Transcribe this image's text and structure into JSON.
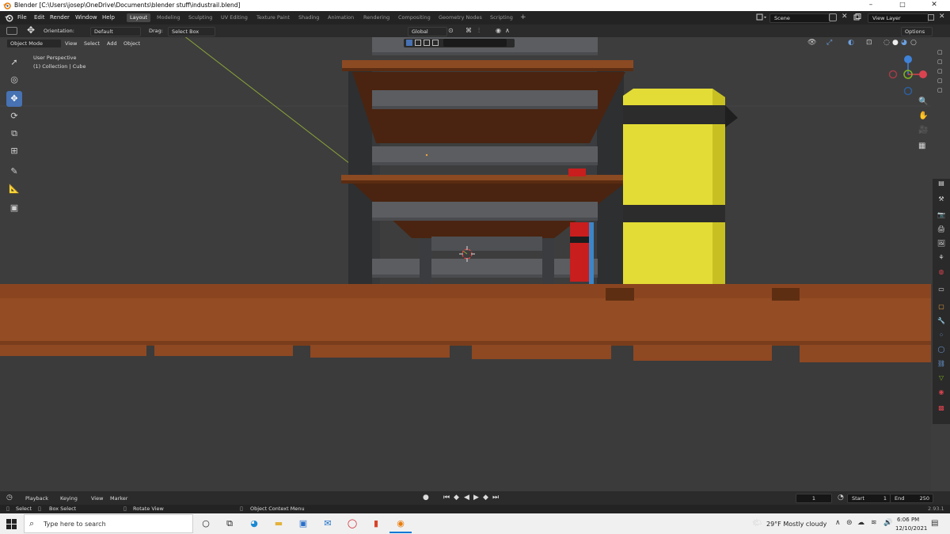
{
  "window": {
    "title": "Blender [C:\\Users\\josep\\OneDrive\\Documents\\blender stuff\\industrail.blend]",
    "controls": [
      "–",
      "□",
      "✕"
    ]
  },
  "menubar": {
    "menus": [
      "File",
      "Edit",
      "Render",
      "Window",
      "Help"
    ],
    "workspaces": [
      "Layout",
      "Modeling",
      "Sculpting",
      "UV Editing",
      "Texture Paint",
      "Shading",
      "Animation",
      "Rendering",
      "Compositing",
      "Geometry Nodes",
      "Scripting"
    ],
    "active_workspace": "Layout",
    "add_workspace": "+",
    "scene": "Scene",
    "view_layer": "View Layer"
  },
  "toolheader": {
    "orientation_label": "Orientation:",
    "orientation_value": "Default",
    "drag_label": "Drag:",
    "drag_value": "Select Box",
    "transform_orientation": "Global",
    "options": "Options"
  },
  "viewheader": {
    "mode": "Object Mode",
    "menus": [
      "View",
      "Select",
      "Add",
      "Object"
    ]
  },
  "viewport": {
    "perspective_label": "User Perspective",
    "collection_label": "(1) Collection | Cube",
    "gizmo_axes": [
      "X",
      "Y",
      "Z"
    ]
  },
  "colors": {
    "accent": "#4772b3",
    "axis_x": "#d9434f",
    "axis_y": "#7fb31f",
    "axis_z": "#3f82d9",
    "crate_wood": "#7a3e1c",
    "shelf_grey": "#5b5d60",
    "barrel_yellow": "#e3dc36",
    "red_object": "#c81e1e"
  },
  "timeline": {
    "menus": [
      "Playback",
      "Keying",
      "View",
      "Marker"
    ],
    "current_frame": "1",
    "start_label": "Start",
    "start_value": "1",
    "end_label": "End",
    "end_value": "250"
  },
  "statusbar": {
    "select": "Select",
    "box_select": "Box Select",
    "rotate_view": "Rotate View",
    "context_menu": "Object Context Menu",
    "version": "2.93.1"
  },
  "taskbar": {
    "search_placeholder": "Type here to search",
    "weather": "29°F  Mostly cloudy",
    "time": "6:06 PM",
    "date": "12/10/2021"
  }
}
